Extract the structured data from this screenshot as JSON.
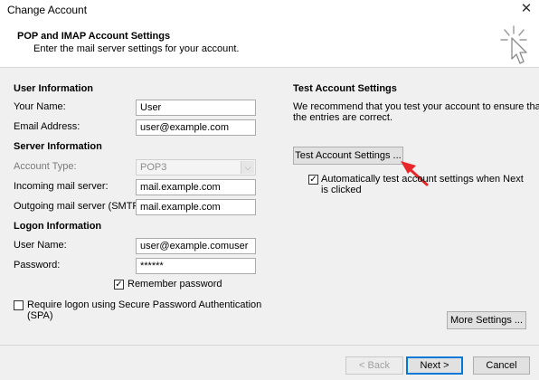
{
  "window": {
    "title": "Change Account",
    "close_icon": "close-icon"
  },
  "header": {
    "title": "POP and IMAP Account Settings",
    "subtitle": "Enter the mail server settings for your account.",
    "icon": "cursor-click-icon"
  },
  "user_info": {
    "heading": "User Information",
    "name_label": "Your Name:",
    "name_value": "User",
    "email_label": "Email Address:",
    "email_value": "user@example.com"
  },
  "server_info": {
    "heading": "Server Information",
    "account_type_label": "Account Type:",
    "account_type_value": "POP3",
    "incoming_label": "Incoming mail server:",
    "incoming_value": "mail.example.com",
    "outgoing_label": "Outgoing mail server (SMTP):",
    "outgoing_value": "mail.example.com"
  },
  "logon_info": {
    "heading": "Logon Information",
    "username_label": "User Name:",
    "username_value": "user@example.comuser",
    "password_label": "Password:",
    "password_value": "******",
    "remember_label": "Remember password",
    "remember_checked": true,
    "spa_label_line1": "Require logon using Secure Password Authentication",
    "spa_label_line2": "(SPA)",
    "spa_checked": false
  },
  "test_settings": {
    "heading": "Test Account Settings",
    "description_line1": "We recommend that you test your account to ensure that",
    "description_line2": "the entries are correct.",
    "test_button": "Test Account Settings ...",
    "auto_test_line1": "Automatically test account settings when Next",
    "auto_test_line2": "is clicked",
    "auto_test_checked": true
  },
  "buttons": {
    "more_settings": "More Settings ...",
    "back": "< Back",
    "next": "Next >",
    "cancel": "Cancel"
  },
  "colors": {
    "accent": "#0078d7",
    "annotation_arrow": "#e8262a"
  }
}
